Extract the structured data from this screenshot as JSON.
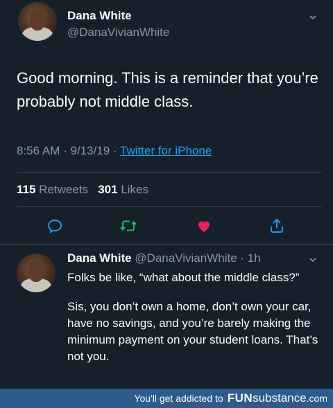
{
  "main_tweet": {
    "display_name": "Dana White",
    "handle": "@DanaVivianWhite",
    "text": "Good morning. This is a reminder that you’re probably not middle class.",
    "time": "8:56 AM",
    "date": "9/13/19",
    "source": "Twitter for iPhone",
    "retweets_count": "115",
    "retweets_label": "Retweets",
    "likes_count": "301",
    "likes_label": "Likes"
  },
  "reply_tweet": {
    "display_name": "Dana White",
    "handle": "@DanaVivianWhite",
    "age": "1h",
    "paragraph_1": "Folks be like, “what about the middle class?”",
    "paragraph_2": "Sis, you don’t own a home, don’t own your car, have no savings, and you’re barely making the minimum payment on your student loans. That’s not you."
  },
  "footer": {
    "promo": "You'll get addicted to",
    "brand_fun": "FUN",
    "brand_substance": "substance",
    "brand_domain": ".com"
  },
  "icons": [
    "chevron-down-icon",
    "reply-icon",
    "retweet-icon",
    "like-icon",
    "share-icon"
  ],
  "colors": {
    "background": "#15202b",
    "link": "#1da1f2",
    "retweet": "#17bf63",
    "like": "#e0245e",
    "muted": "#8899a6",
    "footer": "#2f5b8c"
  }
}
